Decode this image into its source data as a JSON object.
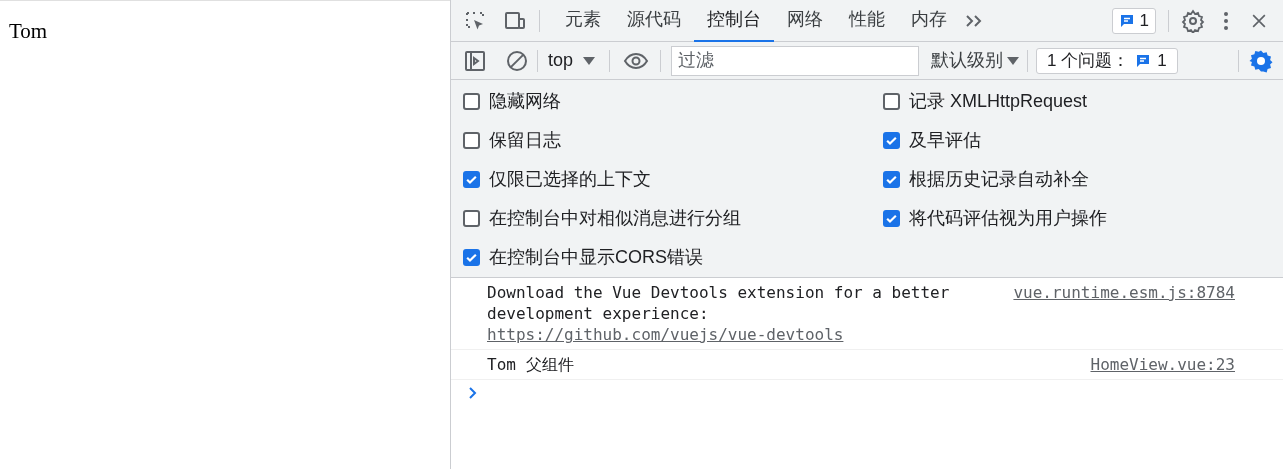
{
  "page": {
    "text": "Tom"
  },
  "devtools": {
    "tabs": [
      {
        "label": "元素",
        "selected": false
      },
      {
        "label": "源代码",
        "selected": false
      },
      {
        "label": "控制台",
        "selected": true
      },
      {
        "label": "网络",
        "selected": false
      },
      {
        "label": "性能",
        "selected": false
      },
      {
        "label": "内存",
        "selected": false
      }
    ],
    "issues_badge": "1",
    "toolbar": {
      "context": "top",
      "filter_placeholder": "过滤",
      "level": "默认级别",
      "issues_label": "1 个问题：",
      "issues_count": "1"
    },
    "settings_left": [
      {
        "label": "隐藏网络",
        "checked": false
      },
      {
        "label": "保留日志",
        "checked": false
      },
      {
        "label": "仅限已选择的上下文",
        "checked": true
      },
      {
        "label": "在控制台中对相似消息进行分组",
        "checked": false
      },
      {
        "label": "在控制台中显示CORS错误",
        "checked": true
      }
    ],
    "settings_right": [
      {
        "label": "记录 XMLHttpRequest",
        "checked": false
      },
      {
        "label": "及早评估",
        "checked": true
      },
      {
        "label": "根据历史记录自动补全",
        "checked": true
      },
      {
        "label": "将代码评估视为用户操作",
        "checked": true
      }
    ],
    "messages": [
      {
        "text": "Download the Vue Devtools extension for a better development experience:",
        "link": "https://github.com/vuejs/vue-devtools",
        "source": "vue.runtime.esm.js:8784"
      },
      {
        "text": "Tom 父组件",
        "source": "HomeView.vue:23"
      }
    ]
  }
}
